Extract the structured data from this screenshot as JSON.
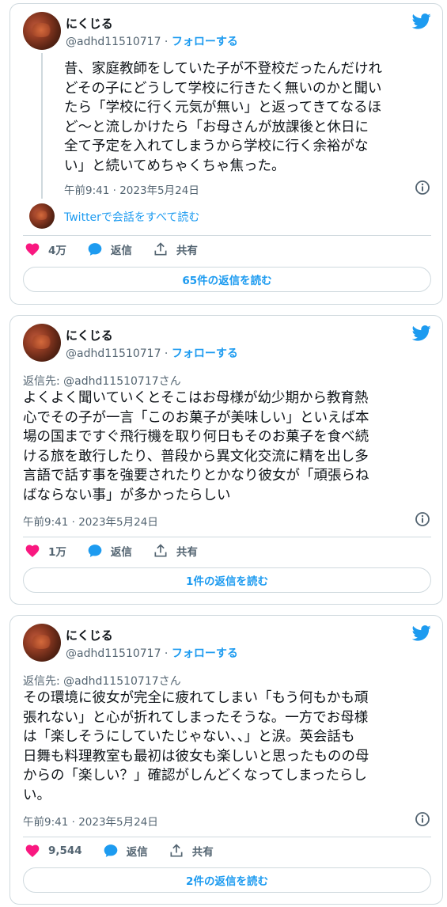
{
  "user": {
    "display_name": "にくじる",
    "handle": "@adhd11510717",
    "separator": " · ",
    "follow_label": "フォローする"
  },
  "icons": {
    "brand": "twitter-bird-icon",
    "like": "heart-icon",
    "reply": "speech-bubble-icon",
    "share": "share-icon",
    "info": "info-icon",
    "colors": {
      "accent": "#1d9bf0",
      "like": "#f91880",
      "muted": "#536471",
      "border": "#cfd9de"
    }
  },
  "labels": {
    "reply": "返信",
    "share": "共有"
  },
  "tweets": [
    {
      "text": "昔、家庭教師をしていた子が不登校だったんだけれ\nどその子にどうして学校に行きたく無いのかと聞い\nたら「学校に行く元気が無い」と返ってきてなるほ\nど〜と流しかけたら「お母さんが放課後と休日に\n全て予定を入れてしまうから学校に行く余裕がな\nい」と続いてめちゃくちゃ焦った。",
      "timestamp": "午前9:41 · 2023年5月24日",
      "read_conversation": "Twitterで会話をすべて読む",
      "likes": "4万",
      "replies_button": "65件の返信を読む"
    },
    {
      "reply_to": "返信先: @adhd11510717さん",
      "text": "よくよく聞いていくとそこはお母様が幼少期から教育熱\n心でその子が一言「このお菓子が美味しい」といえば本\n場の国まですぐ飛行機を取り何日もそのお菓子を食べ続\nける旅を敢行したり、普段から異文化交流に精を出し多\n言語で話す事を強要されたりとかなり彼女が「頑張らね\nばならない事」が多かったらしい",
      "timestamp": "午前9:41 · 2023年5月24日",
      "likes": "1万",
      "replies_button": "1件の返信を読む"
    },
    {
      "reply_to": "返信先: @adhd11510717さん",
      "text": "その環境に彼女が完全に疲れてしまい「もう何もかも頑\n張れない」と心が折れてしまったそうな。一方でお母様\nは「楽しそうにしていたじゃない、、」と涙。英会話も\n日舞も料理教室も最初は彼女も楽しいと思ったものの母\nからの「楽しい？」確認がしんどくなってしまったらし\nい。",
      "timestamp": "午前9:41 · 2023年5月24日",
      "likes": "9,544",
      "replies_button": "2件の返信を読む"
    }
  ]
}
